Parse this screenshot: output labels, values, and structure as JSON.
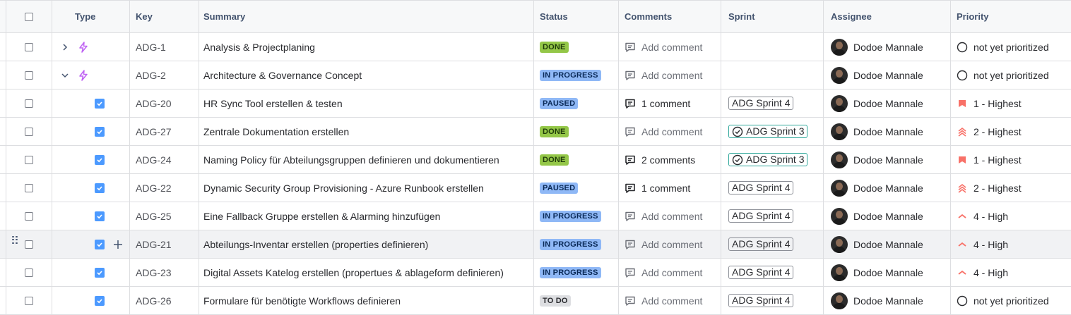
{
  "columns": {
    "type": "Type",
    "key": "Key",
    "summary": "Summary",
    "status": "Status",
    "comments": "Comments",
    "sprint": "Sprint",
    "assignee": "Assignee",
    "priority": "Priority"
  },
  "rows": [
    {
      "key": "ADG-1",
      "summary": "Analysis & Projectplaning",
      "status": "DONE",
      "comments": "Add comment",
      "sprint": "",
      "assignee": "Dodoe Mannale",
      "priority": "not yet prioritized"
    },
    {
      "key": "ADG-2",
      "summary": "Architecture & Governance Concept",
      "status": "IN PROGRESS",
      "comments": "Add comment",
      "sprint": "",
      "assignee": "Dodoe Mannale",
      "priority": "not yet prioritized"
    },
    {
      "key": "ADG-20",
      "summary": "HR Sync Tool erstellen & testen",
      "status": "PAUSED",
      "comments": "1 comment",
      "sprint": "ADG Sprint 4",
      "assignee": "Dodoe Mannale",
      "priority": "1 - Highest"
    },
    {
      "key": "ADG-27",
      "summary": "Zentrale Dokumentation erstellen",
      "status": "DONE",
      "comments": "Add comment",
      "sprint": "ADG Sprint 3",
      "assignee": "Dodoe Mannale",
      "priority": "2 - Highest"
    },
    {
      "key": "ADG-24",
      "summary": "Naming Policy für Abteilungsgruppen definieren und dokumentieren",
      "status": "DONE",
      "comments": "2 comments",
      "sprint": "ADG Sprint 3",
      "assignee": "Dodoe Mannale",
      "priority": "1 - Highest"
    },
    {
      "key": "ADG-22",
      "summary": "Dynamic Security Group Provisioning - Azure Runbook erstellen",
      "status": "PAUSED",
      "comments": "1 comment",
      "sprint": "ADG Sprint 4",
      "assignee": "Dodoe Mannale",
      "priority": "2 - Highest"
    },
    {
      "key": "ADG-25",
      "summary": "Eine Fallback Gruppe erstellen & Alarming hinzufügen",
      "status": "IN PROGRESS",
      "comments": "Add comment",
      "sprint": "ADG Sprint 4",
      "assignee": "Dodoe Mannale",
      "priority": "4 - High"
    },
    {
      "key": "ADG-21",
      "summary": "Abteilungs-Inventar erstellen (properties definieren)",
      "status": "IN PROGRESS",
      "comments": "Add comment",
      "sprint": "ADG Sprint 4",
      "assignee": "Dodoe Mannale",
      "priority": "4 - High"
    },
    {
      "key": "ADG-23",
      "summary": "Digital Assets Katelog erstellen (propertues & ablageform definieren)",
      "status": "IN PROGRESS",
      "comments": "Add comment",
      "sprint": "ADG Sprint 4",
      "assignee": "Dodoe Mannale",
      "priority": "4 - High"
    },
    {
      "key": "ADG-26",
      "summary": "Formulare für benötigte Workflows definieren",
      "status": "TO DO",
      "comments": "Add comment",
      "sprint": "ADG Sprint 4",
      "assignee": "Dodoe Mannale",
      "priority": "not yet prioritized"
    }
  ],
  "colors": {
    "done": "#94c748",
    "in_progress": "#8fb8f6",
    "todo": "#dddee1",
    "priority_highest": "#f87168",
    "epic": "#bf63f3",
    "task": "#4c9aff"
  }
}
